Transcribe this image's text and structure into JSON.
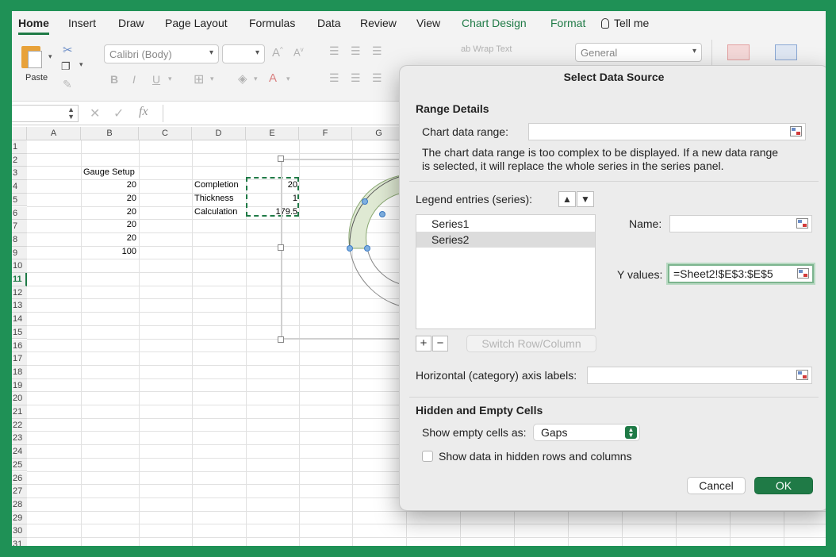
{
  "ribbon_tabs": [
    {
      "label": "Home"
    },
    {
      "label": "Insert"
    },
    {
      "label": "Draw"
    },
    {
      "label": "Page Layout"
    },
    {
      "label": "Formulas"
    },
    {
      "label": "Data"
    },
    {
      "label": "Review"
    },
    {
      "label": "View"
    },
    {
      "label": "Chart Design"
    },
    {
      "label": "Format"
    },
    {
      "label": "Tell me"
    }
  ],
  "ribbon": {
    "paste_label": "Paste",
    "font_name": "Calibri (Body)",
    "wrap_text": "Wrap Text",
    "number_format": "General"
  },
  "formula_bar": {
    "fx": "fx"
  },
  "columns": [
    "A",
    "B",
    "C",
    "D",
    "E",
    "F",
    "G"
  ],
  "rows": [
    "1",
    "2",
    "3",
    "4",
    "5",
    "6",
    "7",
    "8",
    "9",
    "10",
    "11",
    "12",
    "13",
    "14",
    "15",
    "16",
    "17",
    "18",
    "19",
    "20",
    "21",
    "22",
    "23",
    "24",
    "25",
    "26",
    "27",
    "28",
    "29",
    "30",
    "31"
  ],
  "cells": {
    "b2": "Gauge Setup",
    "b3": "20",
    "b4": "20",
    "b5": "20",
    "b6": "20",
    "b7": "20",
    "b8": "100",
    "d3": "Completion",
    "d4": "Thickness",
    "d5": "Calculation",
    "e3": "20",
    "e4": "1",
    "e5": "179.5"
  },
  "dialog": {
    "title": "Select Data Source",
    "range_details": "Range Details",
    "chart_data_range_label": "Chart data range:",
    "chart_data_range_value": "",
    "notice": "The chart data range is too complex to be displayed. If a new data range is selected, it will replace the whole series in the series panel.",
    "legend_label": "Legend entries (series):",
    "series": [
      {
        "name": "Series1"
      },
      {
        "name": "Series2"
      }
    ],
    "name_label": "Name:",
    "name_value": "",
    "y_values_label": "Y values:",
    "y_values_value": "=Sheet2!$E$3:$E$5",
    "switch_label": "Switch Row/Column",
    "axis_labels_label": "Horizontal (category) axis labels:",
    "axis_labels_value": "",
    "hidden_empty": "Hidden and Empty Cells",
    "show_empty_label": "Show empty cells as:",
    "show_empty_value": "Gaps",
    "show_hidden_label": "Show data in hidden rows and columns",
    "cancel": "Cancel",
    "ok": "OK"
  },
  "colors": {
    "accent": "#1f7a46",
    "frame": "#1f9156"
  }
}
